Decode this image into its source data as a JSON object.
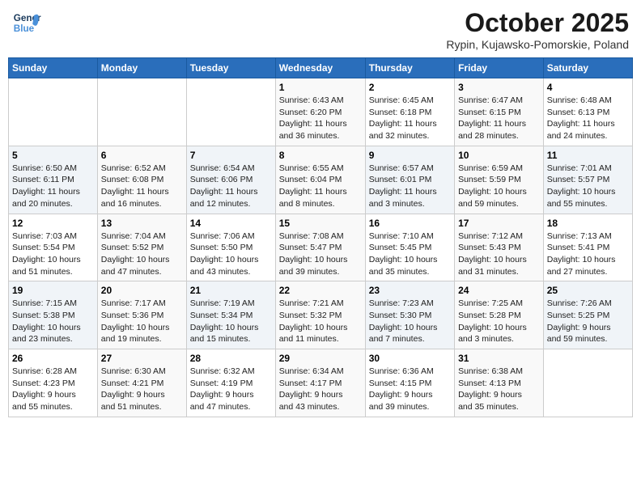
{
  "header": {
    "logo_general": "General",
    "logo_blue": "Blue",
    "month": "October 2025",
    "location": "Rypin, Kujawsko-Pomorskie, Poland"
  },
  "weekdays": [
    "Sunday",
    "Monday",
    "Tuesday",
    "Wednesday",
    "Thursday",
    "Friday",
    "Saturday"
  ],
  "weeks": [
    [
      {
        "day": "",
        "info": ""
      },
      {
        "day": "",
        "info": ""
      },
      {
        "day": "",
        "info": ""
      },
      {
        "day": "1",
        "info": "Sunrise: 6:43 AM\nSunset: 6:20 PM\nDaylight: 11 hours\nand 36 minutes."
      },
      {
        "day": "2",
        "info": "Sunrise: 6:45 AM\nSunset: 6:18 PM\nDaylight: 11 hours\nand 32 minutes."
      },
      {
        "day": "3",
        "info": "Sunrise: 6:47 AM\nSunset: 6:15 PM\nDaylight: 11 hours\nand 28 minutes."
      },
      {
        "day": "4",
        "info": "Sunrise: 6:48 AM\nSunset: 6:13 PM\nDaylight: 11 hours\nand 24 minutes."
      }
    ],
    [
      {
        "day": "5",
        "info": "Sunrise: 6:50 AM\nSunset: 6:11 PM\nDaylight: 11 hours\nand 20 minutes."
      },
      {
        "day": "6",
        "info": "Sunrise: 6:52 AM\nSunset: 6:08 PM\nDaylight: 11 hours\nand 16 minutes."
      },
      {
        "day": "7",
        "info": "Sunrise: 6:54 AM\nSunset: 6:06 PM\nDaylight: 11 hours\nand 12 minutes."
      },
      {
        "day": "8",
        "info": "Sunrise: 6:55 AM\nSunset: 6:04 PM\nDaylight: 11 hours\nand 8 minutes."
      },
      {
        "day": "9",
        "info": "Sunrise: 6:57 AM\nSunset: 6:01 PM\nDaylight: 11 hours\nand 3 minutes."
      },
      {
        "day": "10",
        "info": "Sunrise: 6:59 AM\nSunset: 5:59 PM\nDaylight: 10 hours\nand 59 minutes."
      },
      {
        "day": "11",
        "info": "Sunrise: 7:01 AM\nSunset: 5:57 PM\nDaylight: 10 hours\nand 55 minutes."
      }
    ],
    [
      {
        "day": "12",
        "info": "Sunrise: 7:03 AM\nSunset: 5:54 PM\nDaylight: 10 hours\nand 51 minutes."
      },
      {
        "day": "13",
        "info": "Sunrise: 7:04 AM\nSunset: 5:52 PM\nDaylight: 10 hours\nand 47 minutes."
      },
      {
        "day": "14",
        "info": "Sunrise: 7:06 AM\nSunset: 5:50 PM\nDaylight: 10 hours\nand 43 minutes."
      },
      {
        "day": "15",
        "info": "Sunrise: 7:08 AM\nSunset: 5:47 PM\nDaylight: 10 hours\nand 39 minutes."
      },
      {
        "day": "16",
        "info": "Sunrise: 7:10 AM\nSunset: 5:45 PM\nDaylight: 10 hours\nand 35 minutes."
      },
      {
        "day": "17",
        "info": "Sunrise: 7:12 AM\nSunset: 5:43 PM\nDaylight: 10 hours\nand 31 minutes."
      },
      {
        "day": "18",
        "info": "Sunrise: 7:13 AM\nSunset: 5:41 PM\nDaylight: 10 hours\nand 27 minutes."
      }
    ],
    [
      {
        "day": "19",
        "info": "Sunrise: 7:15 AM\nSunset: 5:38 PM\nDaylight: 10 hours\nand 23 minutes."
      },
      {
        "day": "20",
        "info": "Sunrise: 7:17 AM\nSunset: 5:36 PM\nDaylight: 10 hours\nand 19 minutes."
      },
      {
        "day": "21",
        "info": "Sunrise: 7:19 AM\nSunset: 5:34 PM\nDaylight: 10 hours\nand 15 minutes."
      },
      {
        "day": "22",
        "info": "Sunrise: 7:21 AM\nSunset: 5:32 PM\nDaylight: 10 hours\nand 11 minutes."
      },
      {
        "day": "23",
        "info": "Sunrise: 7:23 AM\nSunset: 5:30 PM\nDaylight: 10 hours\nand 7 minutes."
      },
      {
        "day": "24",
        "info": "Sunrise: 7:25 AM\nSunset: 5:28 PM\nDaylight: 10 hours\nand 3 minutes."
      },
      {
        "day": "25",
        "info": "Sunrise: 7:26 AM\nSunset: 5:25 PM\nDaylight: 9 hours\nand 59 minutes."
      }
    ],
    [
      {
        "day": "26",
        "info": "Sunrise: 6:28 AM\nSunset: 4:23 PM\nDaylight: 9 hours\nand 55 minutes."
      },
      {
        "day": "27",
        "info": "Sunrise: 6:30 AM\nSunset: 4:21 PM\nDaylight: 9 hours\nand 51 minutes."
      },
      {
        "day": "28",
        "info": "Sunrise: 6:32 AM\nSunset: 4:19 PM\nDaylight: 9 hours\nand 47 minutes."
      },
      {
        "day": "29",
        "info": "Sunrise: 6:34 AM\nSunset: 4:17 PM\nDaylight: 9 hours\nand 43 minutes."
      },
      {
        "day": "30",
        "info": "Sunrise: 6:36 AM\nSunset: 4:15 PM\nDaylight: 9 hours\nand 39 minutes."
      },
      {
        "day": "31",
        "info": "Sunrise: 6:38 AM\nSunset: 4:13 PM\nDaylight: 9 hours\nand 35 minutes."
      },
      {
        "day": "",
        "info": ""
      }
    ]
  ]
}
